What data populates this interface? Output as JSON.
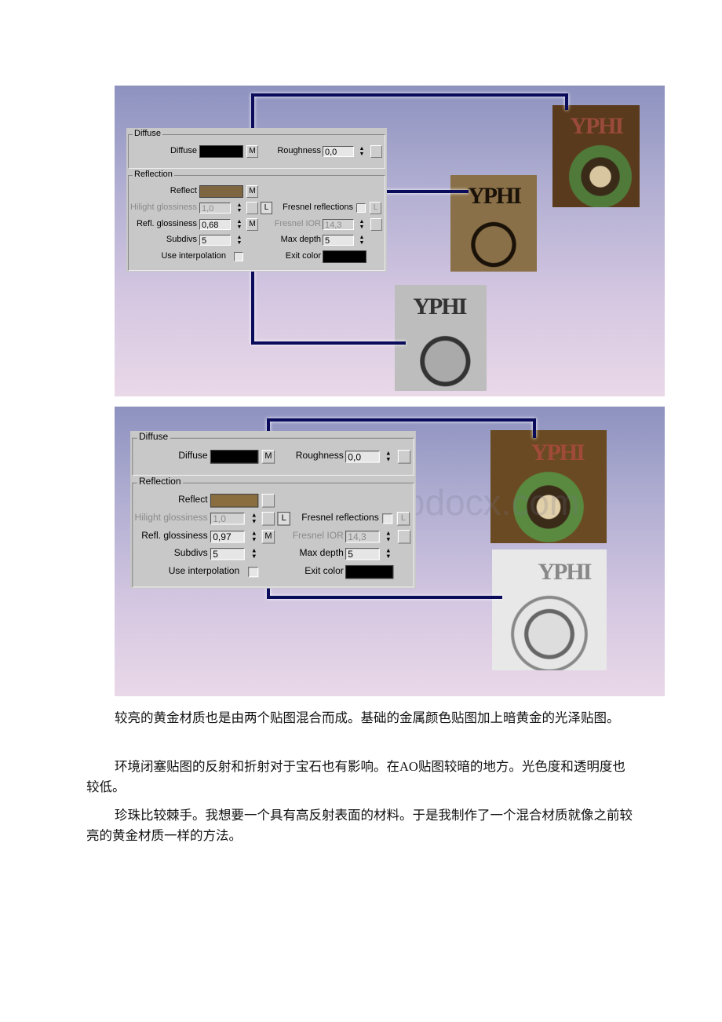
{
  "figures": [
    {
      "diffuse_group": "Diffuse",
      "diffuse_label": "Diffuse",
      "diffuse_color": "#000000",
      "diffuse_map": "M",
      "roughness_label": "Roughness",
      "roughness_value": "0,0",
      "reflection_group": "Reflection",
      "reflect_label": "Reflect",
      "reflect_color": "#7d6640",
      "reflect_map": "M",
      "hilight_label": "Hilight glossiness",
      "hilight_value": "1,0",
      "lock": "L",
      "fresnel_label": "Fresnel reflections",
      "fresnel_lock": "L",
      "refl_gloss_label": "Refl. glossiness",
      "refl_gloss_value": "0,68",
      "refl_gloss_map": "M",
      "fresnel_ior_label": "Fresnel IOR",
      "fresnel_ior_value": "14,3",
      "subdivs_label": "Subdivs",
      "subdivs_value": "5",
      "max_depth_label": "Max depth",
      "max_depth_value": "5",
      "use_interp_label": "Use interpolation",
      "exit_color_label": "Exit color",
      "exit_color": "#000000",
      "thumb_text": "ΥPHI"
    },
    {
      "diffuse_group": "Diffuse",
      "diffuse_label": "Diffuse",
      "diffuse_color": "#000000",
      "diffuse_map": "M",
      "roughness_label": "Roughness",
      "roughness_value": "0,0",
      "reflection_group": "Reflection",
      "reflect_label": "Reflect",
      "reflect_color": "#8a6e40",
      "reflect_map": "",
      "hilight_label": "Hilight glossiness",
      "hilight_value": "1,0",
      "lock": "L",
      "fresnel_label": "Fresnel reflections",
      "fresnel_lock": "L",
      "refl_gloss_label": "Refl. glossiness",
      "refl_gloss_value": "0,97",
      "refl_gloss_map": "M",
      "fresnel_ior_label": "Fresnel IOR",
      "fresnel_ior_value": "14,3",
      "subdivs_label": "Subdivs",
      "subdivs_value": "5",
      "max_depth_label": "Max depth",
      "max_depth_value": "5",
      "use_interp_label": "Use interpolation",
      "exit_color_label": "Exit color",
      "exit_color": "#000000",
      "thumb_text": "ΥPHI"
    }
  ],
  "watermark": "www.bdocx.com",
  "paragraphs": [
    "较亮的黄金材质也是由两个贴图混合而成。基础的金属颜色贴图加上暗黄金的光泽贴图。",
    "环境闭塞贴图的反射和折射对于宝石也有影响。在AO贴图较暗的地方。光色度和透明度也较低。",
    "珍珠比较棘手。我想要一个具有高反射表面的材料。于是我制作了一个混合材质就像之前较亮的黄金材质一样的方法。"
  ],
  "colors": {
    "connector": "#0b0b5c"
  }
}
